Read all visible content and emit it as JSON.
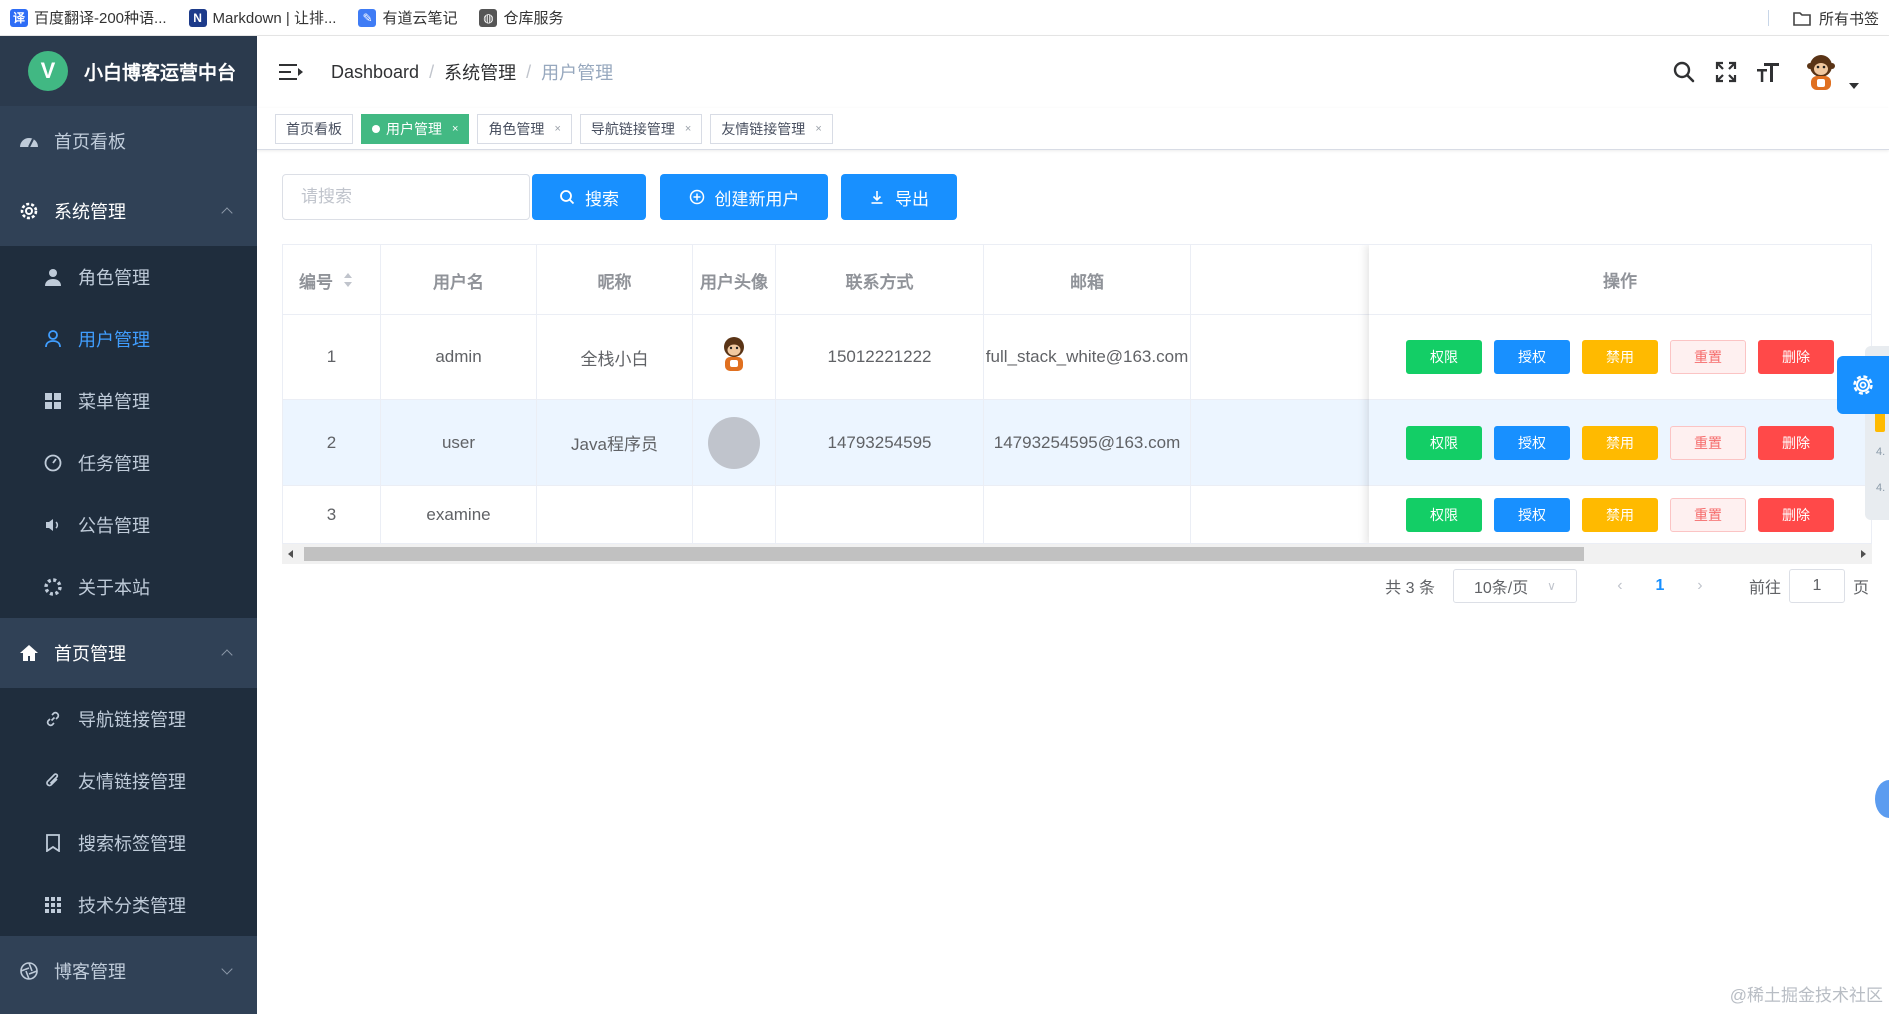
{
  "bookmarks": [
    {
      "label": "百度翻译-200种语...",
      "icon": "translate-icon",
      "color": "#2e6df6",
      "glyph": "译"
    },
    {
      "label": "Markdown | 让排...",
      "icon": "markdown-icon",
      "color": "#1d3b8a",
      "glyph": "N"
    },
    {
      "label": "有道云笔记",
      "icon": "note-icon",
      "color": "#3f7cf5",
      "glyph": "✎"
    },
    {
      "label": "仓库服务",
      "icon": "globe-icon",
      "color": "#555555",
      "glyph": "◍"
    }
  ],
  "bookmarks_all": "所有书签",
  "sidebar": {
    "logo_letter": "V",
    "title": "小白博客运营中台",
    "items": [
      {
        "label": "首页看板",
        "type": "top",
        "icon": "dashboard-icon"
      },
      {
        "label": "系统管理",
        "type": "top",
        "icon": "settings-icon",
        "arrow": "up"
      },
      {
        "label": "角色管理",
        "type": "sub",
        "icon": "user-solid-icon"
      },
      {
        "label": "用户管理",
        "type": "sub",
        "icon": "user-outline-icon",
        "active": true
      },
      {
        "label": "菜单管理",
        "type": "sub",
        "icon": "menu-grid-icon"
      },
      {
        "label": "任务管理",
        "type": "sub",
        "icon": "clock-icon"
      },
      {
        "label": "公告管理",
        "type": "sub",
        "icon": "speaker-icon"
      },
      {
        "label": "关于本站",
        "type": "sub",
        "icon": "gear-icon"
      },
      {
        "label": "首页管理",
        "type": "top",
        "icon": "home-icon",
        "arrow": "up"
      },
      {
        "label": "导航链接管理",
        "type": "sub",
        "icon": "link-icon"
      },
      {
        "label": "友情链接管理",
        "type": "sub",
        "icon": "paperclip-icon"
      },
      {
        "label": "搜索标签管理",
        "type": "sub",
        "icon": "bookmark-icon"
      },
      {
        "label": "技术分类管理",
        "type": "sub",
        "icon": "apps-icon"
      },
      {
        "label": "博客管理",
        "type": "top",
        "icon": "aperture-icon",
        "arrow": "down"
      }
    ]
  },
  "breadcrumb": [
    "Dashboard",
    "系统管理",
    "用户管理"
  ],
  "tags": [
    {
      "label": "首页看板",
      "active": false,
      "closable": false
    },
    {
      "label": "用户管理",
      "active": true,
      "closable": true
    },
    {
      "label": "角色管理",
      "active": false,
      "closable": true
    },
    {
      "label": "导航链接管理",
      "active": false,
      "closable": true
    },
    {
      "label": "友情链接管理",
      "active": false,
      "closable": true
    }
  ],
  "toolbar": {
    "search_placeholder": "请搜索",
    "search_label": "搜索",
    "create_label": "创建新用户",
    "export_label": "导出"
  },
  "table": {
    "columns": [
      "编号",
      "用户名",
      "昵称",
      "用户头像",
      "联系方式",
      "邮箱"
    ],
    "ops_header": "操作",
    "rows": [
      {
        "id": "1",
        "username": "admin",
        "nickname": "全栈小白",
        "avatar": "monkey",
        "phone": "15012221222",
        "email": "full_stack_white@163.com"
      },
      {
        "id": "2",
        "username": "user",
        "nickname": "Java程序员",
        "avatar": "placeholder",
        "phone": "14793254595",
        "email": "14793254595@163.com"
      },
      {
        "id": "3",
        "username": "examine",
        "nickname": "",
        "avatar": "",
        "phone": "",
        "email": ""
      }
    ],
    "actions": [
      {
        "label": "权限",
        "bg": "#13ce66",
        "color": "#fff",
        "border": "#13ce66"
      },
      {
        "label": "授权",
        "bg": "#1890ff",
        "color": "#fff",
        "border": "#1890ff"
      },
      {
        "label": "禁用",
        "bg": "#ffba00",
        "color": "#fff",
        "border": "#ffba00"
      },
      {
        "label": "重置",
        "bg": "#fef0f0",
        "color": "#f56c6c",
        "border": "#fbc4c4"
      },
      {
        "label": "删除",
        "bg": "#ff4949",
        "color": "#fff",
        "border": "#ff4949"
      }
    ]
  },
  "pagination": {
    "total_text": "共 3 条",
    "page_size": "10条/页",
    "current_page": "1",
    "goto_label": "前往",
    "goto_value": "1",
    "page_suffix": "页"
  },
  "side_mini": [
    "4.",
    "4."
  ],
  "watermark": "@稀土掘金技术社区"
}
